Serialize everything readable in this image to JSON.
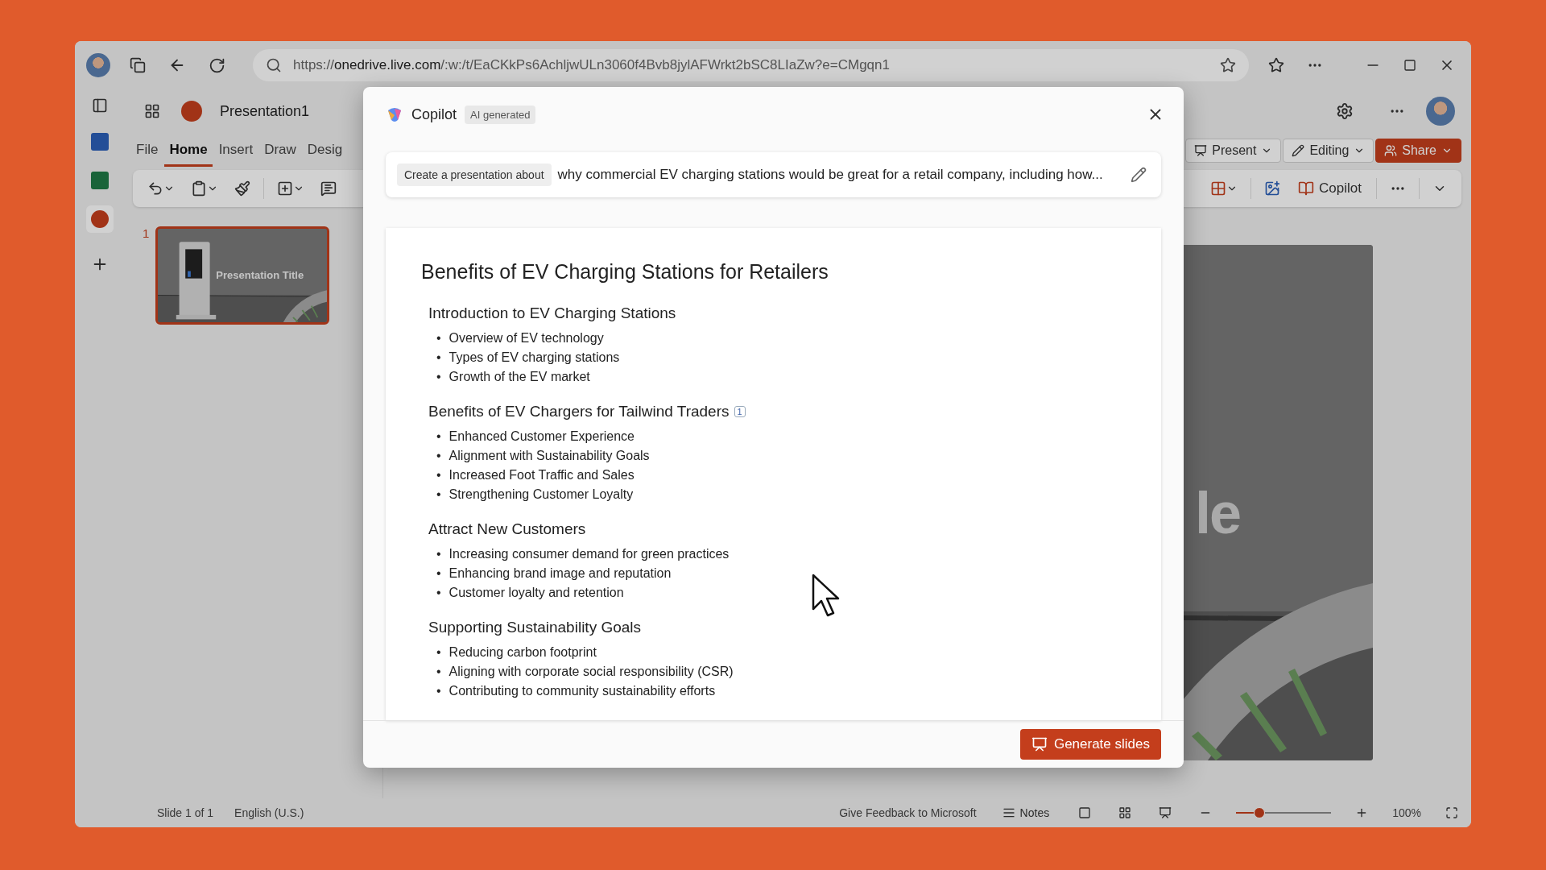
{
  "browser": {
    "url": "https://**onedrive.live.com**/:w:/t/EaCKkPs6AchljwULn3060f4Bvb8jylAFWrkt2bSC8LIaZw?e=CMgqn1"
  },
  "app": {
    "title": "Presentation1",
    "tabs": [
      {
        "label": "File",
        "selected": false
      },
      {
        "label": "Home",
        "selected": true
      },
      {
        "label": "Insert",
        "selected": false
      },
      {
        "label": "Draw",
        "selected": false
      },
      {
        "label": "Desig",
        "selected": false
      }
    ],
    "actions": {
      "present": "Present",
      "editing": "Editing",
      "share": "Share",
      "copilot": "Copilot"
    }
  },
  "slides": [
    {
      "number": "1",
      "title": "Presentation Title",
      "selected": true
    }
  ],
  "canvas": {
    "visible_title": "le"
  },
  "dialog": {
    "title": "Copilot",
    "badge": "AI generated",
    "prompt": {
      "chip": "Create a presentation about",
      "text": "why commercial EV charging stations would be great for a retail company, including how..."
    },
    "outline": {
      "title": "Benefits of EV Charging Stations for Retailers",
      "sections": [
        {
          "heading": "Introduction to EV Charging Stations",
          "items": [
            {
              "bullet": "•",
              "text": "Overview of EV technology"
            },
            {
              "bullet": "•",
              "text": "Types of EV charging stations"
            },
            {
              "bullet": "•",
              "text": "Growth of the EV market"
            }
          ]
        },
        {
          "heading": "Benefits of EV Chargers for Tailwind Traders",
          "citation": "1",
          "items": [
            {
              "bullet": "•",
              "text": "Enhanced Customer Experience"
            },
            {
              "bullet": "•",
              "text": "Alignment with Sustainability Goals"
            },
            {
              "bullet": "•",
              "text": "Increased Foot Traffic and Sales"
            },
            {
              "bullet": "•",
              "text": "Strengthening Customer Loyalty"
            }
          ]
        },
        {
          "heading": "Attract New Customers",
          "items": [
            {
              "bullet": "•",
              "text": "Increasing consumer demand for green practices"
            },
            {
              "bullet": "•",
              "text": "Enhancing brand image and reputation"
            },
            {
              "bullet": "•",
              "text": "Customer loyalty and retention"
            }
          ]
        },
        {
          "heading": "Supporting Sustainability Goals",
          "items": [
            {
              "bullet": "•",
              "text": "Reducing carbon footprint"
            },
            {
              "bullet": "•",
              "text": "Aligning with corporate social responsibility (CSR)"
            },
            {
              "bullet": "•",
              "text": "Contributing to community sustainability efforts"
            }
          ]
        }
      ]
    },
    "button": "Generate slides"
  },
  "status_bar": {
    "slide": "Slide 1 of 1",
    "language": "English (U.S.)",
    "feedback": "Give Feedback to Microsoft",
    "notes": "Notes",
    "zoom": "100%",
    "zoom_slider": {
      "level": 0.24
    }
  }
}
